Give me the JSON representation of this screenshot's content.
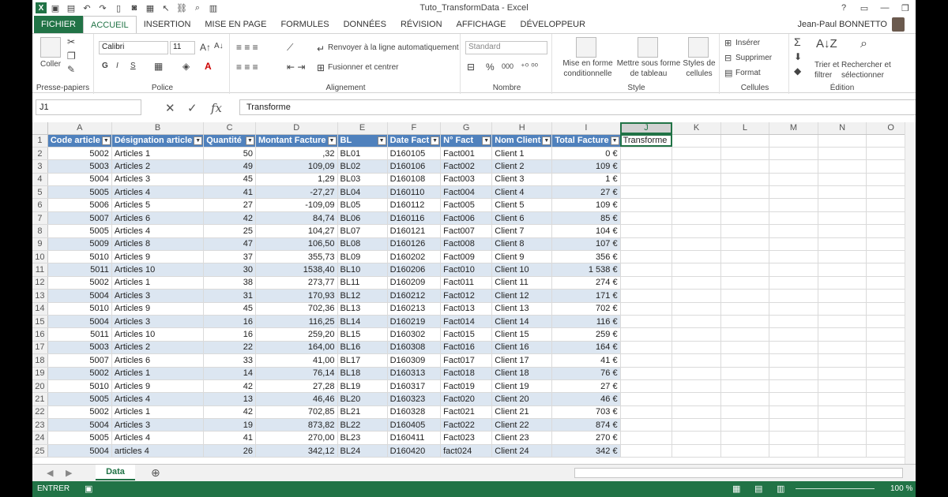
{
  "window": {
    "title": "Tuto_TransformData - Excel"
  },
  "tabs": [
    {
      "label": "FICHIER",
      "kind": "file"
    },
    {
      "label": "ACCUEIL",
      "kind": "active"
    },
    {
      "label": "INSERTION"
    },
    {
      "label": "MISE EN PAGE"
    },
    {
      "label": "FORMULES"
    },
    {
      "label": "DONNÉES"
    },
    {
      "label": "RÉVISION"
    },
    {
      "label": "AFFICHAGE"
    },
    {
      "label": "DÉVELOPPEUR"
    }
  ],
  "user": {
    "name": "Jean-Paul BONNETTO"
  },
  "ribbon": {
    "clipboard": {
      "paste": "Coller",
      "label": "Presse-papiers"
    },
    "font": {
      "name": "Calibri",
      "size": "11",
      "bold": "G",
      "italic": "I",
      "underline": "S",
      "label": "Police"
    },
    "alignment": {
      "wrap": "Renvoyer à la ligne automatiquement",
      "merge": "Fusionner et centrer",
      "label": "Alignement"
    },
    "number": {
      "format": "Standard",
      "label": "Nombre"
    },
    "styles": {
      "cond1": "Mise en forme",
      "cond2": "conditionnelle",
      "table1": "Mettre sous forme",
      "table2": "de tableau",
      "cell1": "Styles de",
      "cell2": "cellules",
      "label": "Style"
    },
    "cells": {
      "insert": "Insérer",
      "delete": "Supprimer",
      "format": "Format",
      "label": "Cellules"
    },
    "editing": {
      "sort1": "Trier et",
      "sort2": "filtrer",
      "find1": "Rechercher et",
      "find2": "sélectionner",
      "label": "Édition"
    }
  },
  "formula_bar": {
    "name_box": "J1",
    "fx": "fx",
    "content": "Transforme"
  },
  "grid": {
    "columns": [
      "A",
      "B",
      "C",
      "D",
      "E",
      "F",
      "G",
      "H",
      "I",
      "J",
      "K",
      "L",
      "M",
      "N",
      "O"
    ],
    "headers": [
      "Code article",
      "Désignation article",
      "Quantité",
      "Montant Facture",
      "BL",
      "Date Fact",
      "N° Fact",
      "Nom Client",
      "Total Facture",
      "Transforme"
    ],
    "rows": [
      [
        "5002",
        "Articles 1",
        "50",
        ",32",
        "BL01",
        "D160105",
        "Fact001",
        "Client 1",
        "0 €"
      ],
      [
        "5003",
        "Articles 2",
        "49",
        "109,09",
        "BL02",
        "D160106",
        "Fact002",
        "Client 2",
        "109 €"
      ],
      [
        "5004",
        "Articles 3",
        "45",
        "1,29",
        "BL03",
        "D160108",
        "Fact003",
        "Client 3",
        "1 €"
      ],
      [
        "5005",
        "Articles 4",
        "41",
        "-27,27",
        "BL04",
        "D160110",
        "Fact004",
        "Client 4",
        "27 €"
      ],
      [
        "5006",
        "Articles 5",
        "27",
        "-109,09",
        "BL05",
        "D160112",
        "Fact005",
        "Client 5",
        "109 €"
      ],
      [
        "5007",
        "Articles 6",
        "42",
        "84,74",
        "BL06",
        "D160116",
        "Fact006",
        "Client 6",
        "85 €"
      ],
      [
        "5005",
        "Articles 4",
        "25",
        "104,27",
        "BL07",
        "D160121",
        "Fact007",
        "Client 7",
        "104 €"
      ],
      [
        "5009",
        "Articles 8",
        "47",
        "106,50",
        "BL08",
        "D160126",
        "Fact008",
        "Client 8",
        "107 €"
      ],
      [
        "5010",
        "Articles 9",
        "37",
        "355,73",
        "BL09",
        "D160202",
        "Fact009",
        "Client 9",
        "356 €"
      ],
      [
        "5011",
        "Articles 10",
        "30",
        "1538,40",
        "BL10",
        "D160206",
        "Fact010",
        "Client 10",
        "1 538 €"
      ],
      [
        "5002",
        "Articles 1",
        "38",
        "273,77",
        "BL11",
        "D160209",
        "Fact011",
        "Client 11",
        "274 €"
      ],
      [
        "5004",
        "Articles 3",
        "31",
        "170,93",
        "BL12",
        "D160212",
        "Fact012",
        "Client 12",
        "171 €"
      ],
      [
        "5010",
        "Articles 9",
        "45",
        "702,36",
        "BL13",
        "D160213",
        "Fact013",
        "Client 13",
        "702 €"
      ],
      [
        "5004",
        "Articles 3",
        "16",
        "116,25",
        "BL14",
        "D160219",
        "Fact014",
        "Client 14",
        "116 €"
      ],
      [
        "5011",
        "Articles 10",
        "16",
        "259,20",
        "BL15",
        "D160302",
        "Fact015",
        "Client 15",
        "259 €"
      ],
      [
        "5003",
        "Articles 2",
        "22",
        "164,00",
        "BL16",
        "D160308",
        "Fact016",
        "Client 16",
        "164 €"
      ],
      [
        "5007",
        "Articles 6",
        "33",
        "41,00",
        "BL17",
        "D160309",
        "Fact017",
        "Client 17",
        "41 €"
      ],
      [
        "5002",
        "Articles 1",
        "14",
        "76,14",
        "BL18",
        "D160313",
        "Fact018",
        "Client 18",
        "76 €"
      ],
      [
        "5010",
        "Articles 9",
        "42",
        "27,28",
        "BL19",
        "D160317",
        "Fact019",
        "Client 19",
        "27 €"
      ],
      [
        "5005",
        "Articles 4",
        "13",
        "46,46",
        "BL20",
        "D160323",
        "Fact020",
        "Client 20",
        "46 €"
      ],
      [
        "5002",
        "Articles 1",
        "42",
        "702,85",
        "BL21",
        "D160328",
        "Fact021",
        "Client 21",
        "703 €"
      ],
      [
        "5004",
        "Articles 3",
        "19",
        "873,82",
        "BL22",
        "D160405",
        "Fact022",
        "Client 22",
        "874 €"
      ],
      [
        "5005",
        "Articles 4",
        "41",
        "270,00",
        "BL23",
        "D160411",
        "Fact023",
        "Client 23",
        "270 €"
      ],
      [
        "5004",
        "articles 4",
        "26",
        "342,12",
        "BL24",
        "D160420",
        "fact024",
        "Client 24",
        "342 €"
      ]
    ]
  },
  "sheets": {
    "active": "Data",
    "add": "⊕"
  },
  "status": {
    "mode": "ENTRER",
    "zoom": "100 %"
  },
  "colors": {
    "accent": "#217346",
    "table_header": "#4f81bd",
    "band": "#dce6f1"
  }
}
